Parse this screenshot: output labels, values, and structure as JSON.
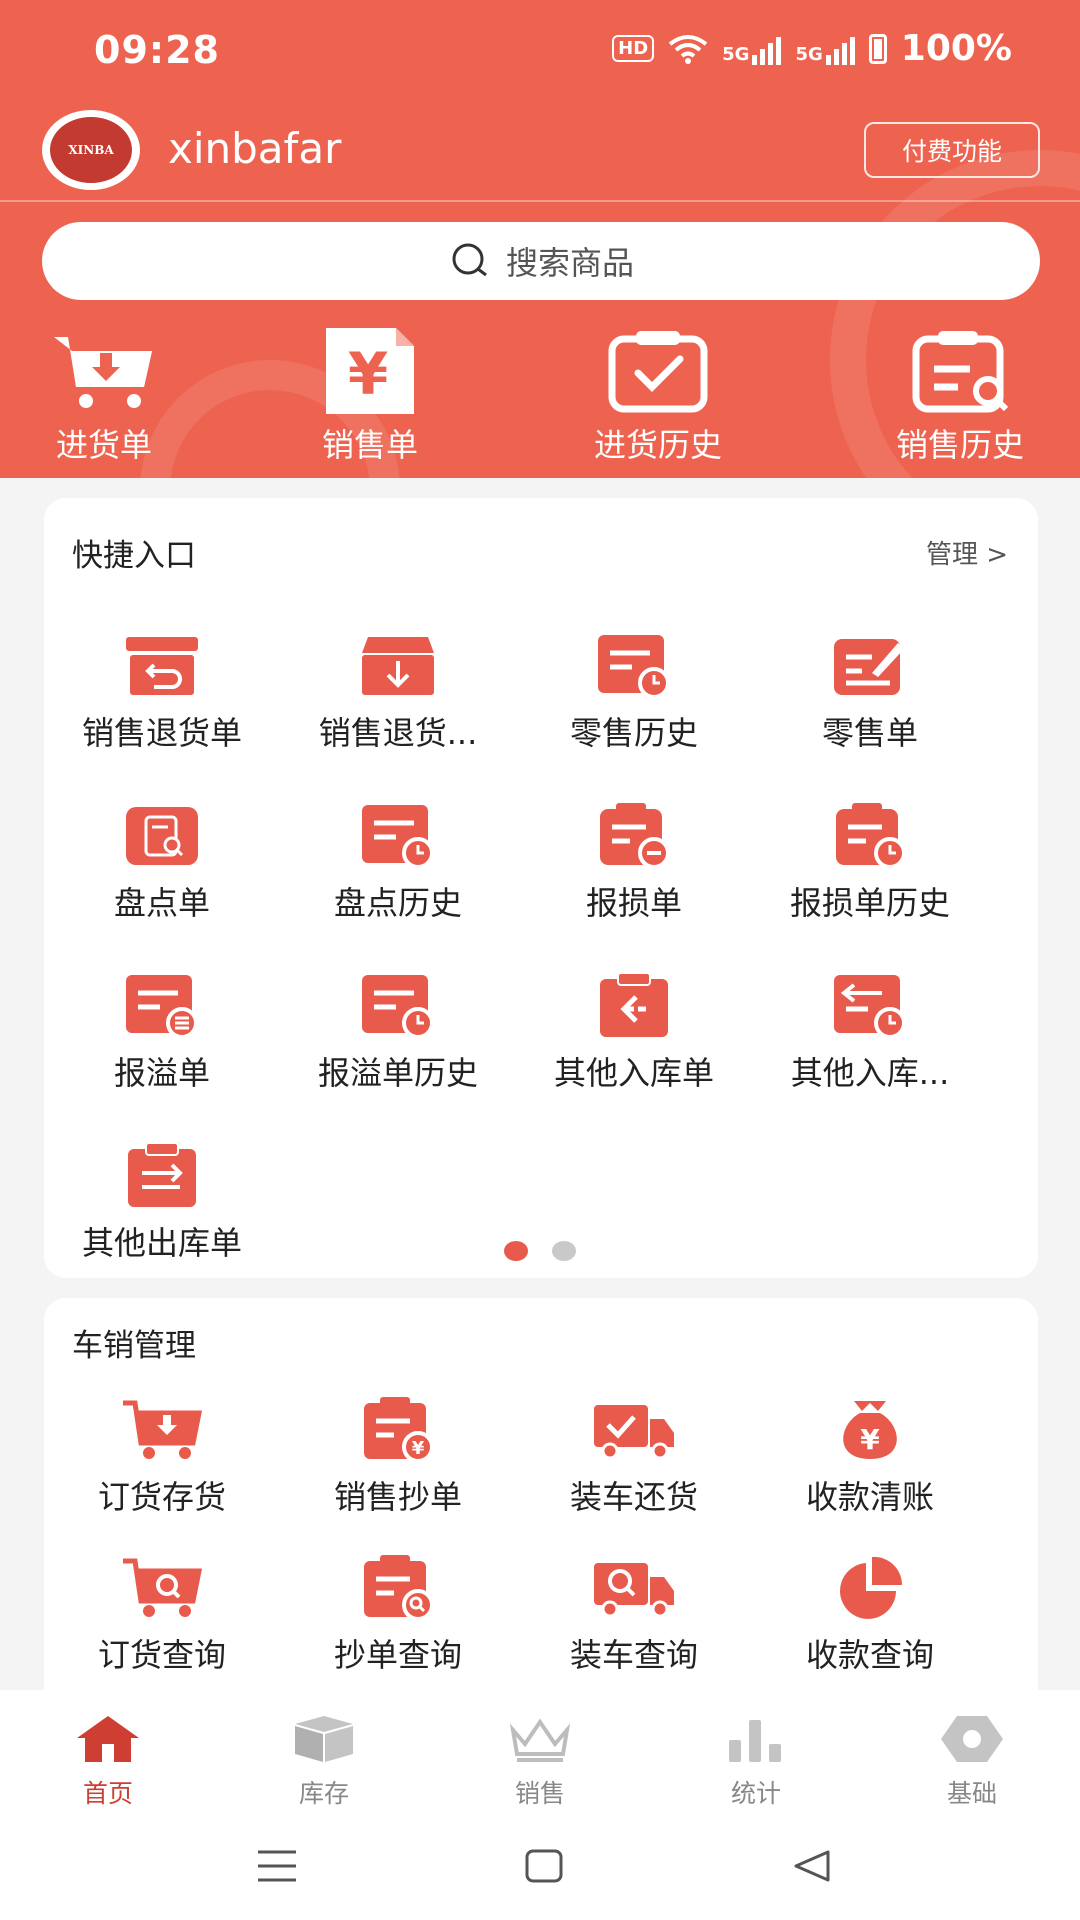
{
  "status_bar": {
    "time": "09:28",
    "hd": "HD",
    "network1": "5G",
    "network2": "5G",
    "battery": "100%"
  },
  "colors": {
    "primary": "#ee6350",
    "icon": "#e85a4c",
    "active_nav": "#cf3e32"
  },
  "header": {
    "logo_text": "XINBA",
    "username": "xinbafar",
    "paid_button": "付费功能"
  },
  "search": {
    "placeholder": "搜索商品"
  },
  "top_actions": [
    {
      "label": "进货单",
      "icon": "cart-down-icon"
    },
    {
      "label": "销售单",
      "icon": "yen-document-icon"
    },
    {
      "label": "进货历史",
      "icon": "clipboard-check-icon"
    },
    {
      "label": "销售历史",
      "icon": "clipboard-search-icon"
    }
  ],
  "quick": {
    "title": "快捷入口",
    "manage": "管理 >",
    "items": [
      {
        "label": "销售退货单",
        "icon": "return-box-icon"
      },
      {
        "label": "销售退货...",
        "icon": "box-down-icon"
      },
      {
        "label": "零售历史",
        "icon": "doc-clock-icon"
      },
      {
        "label": "零售单",
        "icon": "edit-doc-icon"
      },
      {
        "label": "盘点单",
        "icon": "doc-search-icon"
      },
      {
        "label": "盘点历史",
        "icon": "doc-clock-icon"
      },
      {
        "label": "报损单",
        "icon": "clipboard-minus-icon"
      },
      {
        "label": "报损单历史",
        "icon": "clipboard-clock-icon"
      },
      {
        "label": "报溢单",
        "icon": "doc-coins-icon"
      },
      {
        "label": "报溢单历史",
        "icon": "doc-clock-icon"
      },
      {
        "label": "其他入库单",
        "icon": "clipboard-in-icon"
      },
      {
        "label": "其他入库...",
        "icon": "doc-in-clock-icon"
      },
      {
        "label": "其他出库单",
        "icon": "clipboard-out-icon"
      }
    ],
    "pages": 2,
    "current_page": 1
  },
  "car_sales": {
    "title": "车销管理",
    "items": [
      {
        "label": "订货存货",
        "icon": "cart-down-icon"
      },
      {
        "label": "销售抄单",
        "icon": "clipboard-yen-icon"
      },
      {
        "label": "装车还货",
        "icon": "truck-check-icon"
      },
      {
        "label": "收款清账",
        "icon": "money-bag-icon"
      },
      {
        "label": "订货查询",
        "icon": "cart-search-icon"
      },
      {
        "label": "抄单查询",
        "icon": "clipboard-search-icon"
      },
      {
        "label": "装车查询",
        "icon": "truck-search-icon"
      },
      {
        "label": "收款查询",
        "icon": "pie-chart-icon"
      }
    ]
  },
  "bottom_nav": [
    {
      "label": "首页",
      "icon": "home-icon",
      "active": true
    },
    {
      "label": "库存",
      "icon": "box-icon",
      "active": false
    },
    {
      "label": "销售",
      "icon": "crown-icon",
      "active": false
    },
    {
      "label": "统计",
      "icon": "bar-chart-icon",
      "active": false
    },
    {
      "label": "基础",
      "icon": "hexagon-icon",
      "active": false
    }
  ],
  "system_nav": {
    "menu": "menu-icon",
    "home": "square-icon",
    "back": "back-triangle-icon"
  }
}
